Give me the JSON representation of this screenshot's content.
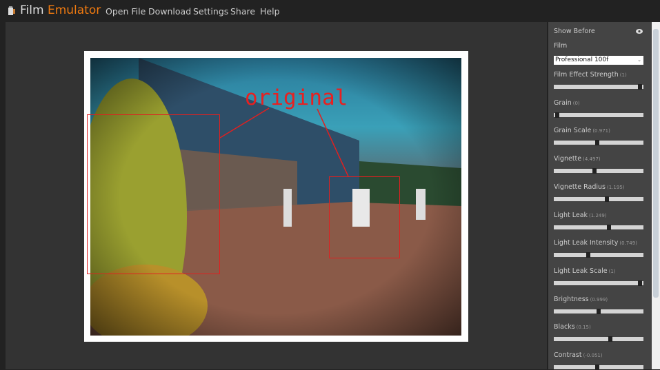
{
  "header": {
    "brand_a": "Film",
    "brand_b": "Emulator",
    "nav": [
      "Open File",
      "Download",
      "Settings",
      "Share",
      "Help"
    ]
  },
  "canvas": {
    "annotation": "original"
  },
  "sidebar": {
    "show_before": "Show Before",
    "film_label": "Film",
    "film_value": "Professional 100f",
    "sliders": [
      {
        "label": "Film Effect Strength",
        "value": "(1)",
        "pos": 0.98
      },
      {
        "label": "Grain",
        "value": "(0)",
        "pos": 0.02
      },
      {
        "label": "Grain Scale",
        "value": "(0.971)",
        "pos": 0.48
      },
      {
        "label": "Vignette",
        "value": "(4.497)",
        "pos": 0.45
      },
      {
        "label": "Vignette Radius",
        "value": "(1.195)",
        "pos": 0.6
      },
      {
        "label": "Light Leak",
        "value": "(1.249)",
        "pos": 0.62
      },
      {
        "label": "Light Leak Intensity",
        "value": "(0.749)",
        "pos": 0.38
      },
      {
        "label": "Light Leak Scale",
        "value": "(1)",
        "pos": 0.98
      },
      {
        "label": "Brightness",
        "value": "(0.999)",
        "pos": 0.5
      },
      {
        "label": "Blacks",
        "value": "(0.15)",
        "pos": 0.64
      },
      {
        "label": "Contrast",
        "value": "(-0.051)",
        "pos": 0.48
      }
    ]
  }
}
